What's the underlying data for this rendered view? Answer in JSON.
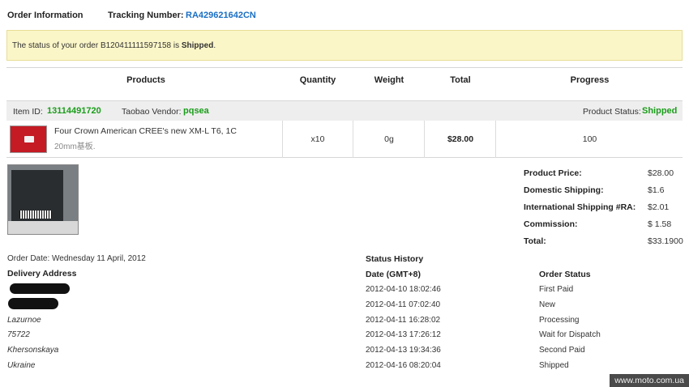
{
  "header": {
    "order_info_label": "Order Information",
    "tracking_label": "Tracking Number:",
    "tracking_number": "RA429621642CN"
  },
  "notice": {
    "prefix": "The status of your order ",
    "order_id": "B120411111597158",
    "middle": " is ",
    "status": "Shipped",
    "suffix": "."
  },
  "table": {
    "columns": [
      "Products",
      "Quantity",
      "Weight",
      "Total",
      "Progress"
    ],
    "item": {
      "item_id_label": "Item ID:",
      "item_id": "13114491720",
      "vendor_label": "Taobao Vendor:",
      "vendor": "pqsea",
      "status_label": "Product Status:",
      "status": "Shipped",
      "name": "Four Crown American CREE's new XM-L T6, 1C",
      "name_sub": "20mm基板.",
      "quantity": "x10",
      "weight": "0g",
      "total": "$28.00",
      "progress": "100"
    }
  },
  "summary": [
    {
      "label": "Product Price:",
      "value": "$28.00"
    },
    {
      "label": "Domestic Shipping:",
      "value": "$1.6"
    },
    {
      "label": "International Shipping #RA:",
      "value": "$2.01"
    },
    {
      "label": "Commission:",
      "value": "$ 1.58"
    },
    {
      "label": "Total:",
      "value": "$33.1900"
    }
  ],
  "order": {
    "order_date": "Order Date: Wednesday 11 April, 2012",
    "delivery_label": "Delivery Address",
    "address_lines": [
      "Lazurnoe",
      "75722",
      "Khersonskaya",
      "Ukraine"
    ]
  },
  "history": {
    "title": "Status History",
    "date_header": "Date (GMT+8)",
    "status_header": "Order Status",
    "rows": [
      {
        "date": "2012-04-10 18:02:46",
        "status": "First Paid"
      },
      {
        "date": "2012-04-11 07:02:40",
        "status": "New"
      },
      {
        "date": "2012-04-11 16:28:02",
        "status": "Processing"
      },
      {
        "date": "2012-04-13 17:26:12",
        "status": "Wait for Dispatch"
      },
      {
        "date": "2012-04-13 19:34:36",
        "status": "Second Paid"
      },
      {
        "date": "2012-04-16 08:20:04",
        "status": "Shipped"
      }
    ]
  },
  "watermark": "www.moto.com.ua"
}
